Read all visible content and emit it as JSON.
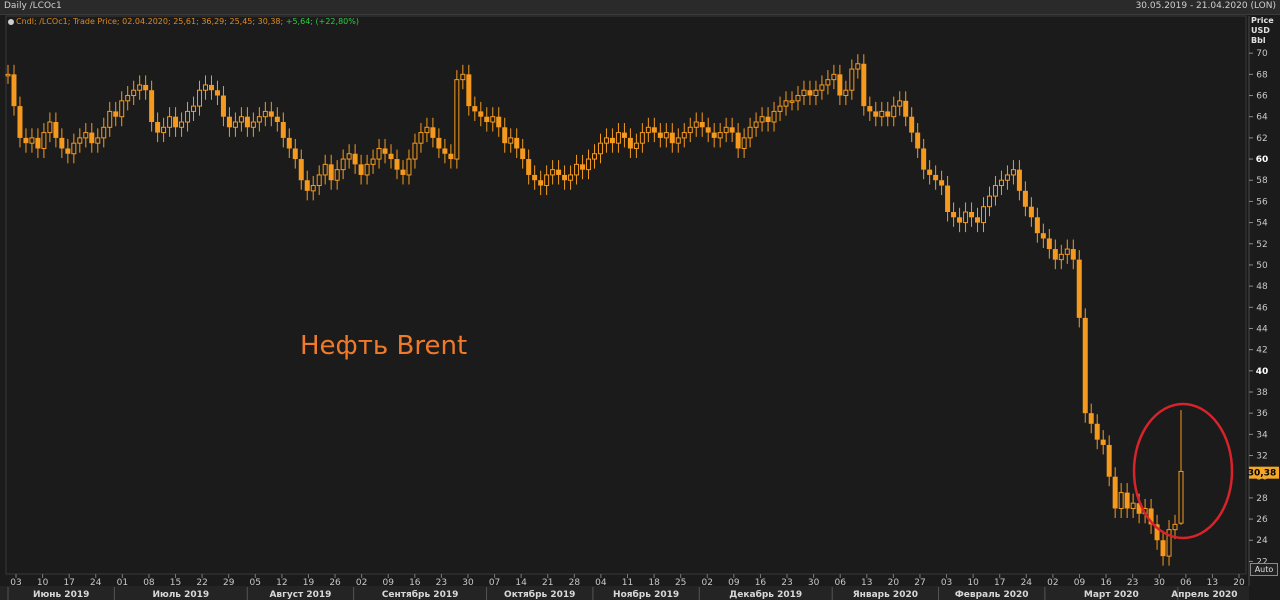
{
  "header": {
    "left_title": "Daily /LCOc1",
    "right_range": "30.05.2019 - 21.04.2020 (LON)"
  },
  "legend": {
    "text_main": "Cndl; /LCOc1; Trade Price; 02.04.2020; 25,61; 36,29; 25,45; 30,38;",
    "text_change": "+5,64; (+22,80%)"
  },
  "price_axis_header": [
    "Price",
    "USD",
    "Bbl"
  ],
  "auto_label": "Auto",
  "annotation": "Нефть Brent",
  "last_price_label": "30,38",
  "colors": {
    "background": "#1b1b1b",
    "candle": "#f59a1e",
    "grid": "#2c2c2c",
    "circle": "#d8232a",
    "last_price_bg": "#f5a623",
    "annotation": "#f07a2a"
  },
  "chart_data": {
    "type": "candlestick",
    "ylim": [
      21,
      72
    ],
    "y_ticks": [
      22,
      24,
      26,
      28,
      30,
      32,
      34,
      36,
      38,
      40,
      42,
      44,
      46,
      48,
      50,
      52,
      54,
      56,
      58,
      60,
      62,
      64,
      66,
      68,
      70
    ],
    "y_bold_ticks": [
      40,
      60
    ],
    "x_day_ticks": [
      "03",
      "10",
      "17",
      "24",
      "01",
      "08",
      "15",
      "22",
      "29",
      "05",
      "12",
      "19",
      "26",
      "02",
      "09",
      "16",
      "23",
      "30",
      "07",
      "14",
      "21",
      "28",
      "04",
      "11",
      "18",
      "25",
      "02",
      "09",
      "16",
      "23",
      "30",
      "06",
      "13",
      "20",
      "27",
      "03",
      "10",
      "17",
      "24",
      "02",
      "09",
      "16",
      "23",
      "30",
      "06",
      "13",
      "20"
    ],
    "x_months": [
      "Июнь 2019",
      "Июль 2019",
      "Август 2019",
      "Сентябрь 2019",
      "Октябрь 2019",
      "Ноябрь 2019",
      "Декабрь 2019",
      "Январь 2020",
      "Февраль 2020",
      "Март 2020",
      "Апрель 2020"
    ],
    "month_start_tick_index": [
      0,
      4,
      9,
      13,
      18,
      22,
      26,
      31,
      35,
      39,
      44
    ],
    "month_end_tick_index": [
      4,
      9,
      13,
      18,
      22,
      26,
      31,
      35,
      39,
      44,
      47
    ],
    "closes": [
      68.0,
      65.0,
      62.0,
      61.5,
      62.0,
      61.0,
      62.5,
      63.5,
      62.0,
      61.0,
      60.5,
      61.5,
      62.0,
      62.5,
      61.5,
      62.0,
      63.0,
      64.5,
      64.0,
      65.5,
      66.0,
      66.5,
      67.0,
      66.5,
      63.5,
      62.5,
      63.0,
      64.0,
      63.0,
      63.5,
      64.5,
      65.0,
      66.5,
      67.0,
      66.5,
      66.0,
      64.0,
      63.0,
      63.5,
      64.0,
      63.0,
      63.5,
      64.0,
      64.5,
      64.0,
      63.5,
      62.0,
      61.0,
      60.0,
      58.0,
      57.0,
      57.5,
      58.5,
      59.5,
      58.0,
      59.0,
      60.0,
      60.5,
      59.5,
      58.5,
      59.5,
      60.0,
      61.0,
      60.5,
      60.0,
      59.0,
      58.5,
      60.0,
      61.5,
      62.5,
      63.0,
      62.0,
      61.0,
      60.5,
      60.0,
      67.5,
      68.0,
      65.0,
      64.5,
      64.0,
      63.5,
      64.0,
      63.0,
      61.5,
      62.0,
      61.0,
      60.0,
      58.5,
      58.0,
      57.5,
      58.5,
      59.0,
      58.5,
      58.0,
      58.5,
      59.5,
      59.0,
      60.0,
      60.5,
      61.5,
      62.0,
      61.5,
      62.5,
      62.0,
      61.0,
      61.5,
      62.5,
      63.0,
      62.5,
      62.0,
      62.5,
      61.5,
      62.0,
      62.5,
      63.0,
      63.5,
      63.0,
      62.5,
      62.0,
      62.5,
      63.0,
      62.5,
      61.0,
      62.0,
      63.0,
      63.5,
      64.0,
      63.5,
      64.5,
      65.0,
      65.5,
      65.5,
      66.0,
      66.5,
      66.0,
      66.5,
      67.0,
      67.5,
      68.0,
      66.0,
      66.5,
      68.5,
      69.0,
      65.0,
      64.5,
      64.0,
      64.5,
      64.0,
      65.0,
      65.5,
      64.0,
      62.5,
      61.0,
      59.0,
      58.5,
      58.0,
      57.5,
      55.0,
      54.5,
      54.0,
      55.0,
      54.5,
      54.0,
      55.5,
      56.5,
      57.5,
      58.0,
      58.5,
      59.0,
      57.0,
      55.5,
      54.5,
      53.0,
      52.5,
      51.5,
      50.5,
      51.0,
      51.5,
      50.5,
      45.0,
      36.0,
      35.0,
      33.5,
      33.0,
      30.0,
      27.0,
      28.5,
      27.0,
      27.5,
      26.5,
      27.0,
      25.5,
      24.0,
      22.5,
      25.0,
      25.5,
      30.5
    ],
    "last": {
      "date": "02.04.2020",
      "open": 25.61,
      "high": 36.29,
      "low": 25.45,
      "close": 30.38,
      "change": 5.64,
      "change_pct": 22.8
    },
    "grid": false
  }
}
